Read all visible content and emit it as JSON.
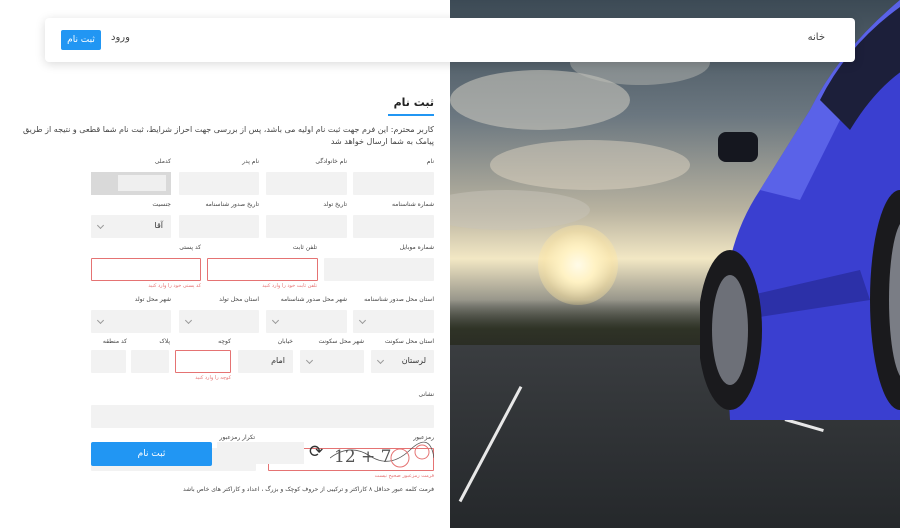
{
  "nav": {
    "home": "خانه",
    "login": "ورود",
    "register": "ثبت نام"
  },
  "form": {
    "title": "ثبت نام",
    "intro": "کاربر محترم: این فرم جهت ثبت نام اولیه می باشد، پس از بررسی جهت احراز شرایط، ثبت نام شما قطعی و نتیجه از طریق پیامک به شما ارسال خواهد شد",
    "labels": {
      "first_name": "نام",
      "last_name": "نام خانوادگی",
      "father_name": "نام پدر",
      "national_code": "کدملی",
      "id_number": "شماره شناسنامه",
      "birth_date": "تاریخ تولد",
      "id_issue_date": "تاریخ صدور شناسنامه",
      "gender": "جنسیت",
      "mobile": "شماره موبایل",
      "phone": "تلفن ثابت",
      "postal_code": "کد پستی",
      "issue_province": "استان محل صدور شناسنامه",
      "issue_city": "شهر محل صدور شناسنامه",
      "birth_province": "استان محل تولد",
      "birth_city": "شهر محل تولد",
      "res_province": "استان محل سکونت",
      "res_city": "شهر محل سکونت",
      "street": "خیابان",
      "alley": "کوچه",
      "plaque": "پلاک",
      "area_code": "کد منطقه",
      "address": "نشانی",
      "password": "رمزعبور",
      "password_repeat": "تکرار رمزعبور"
    },
    "values": {
      "gender": "آقا",
      "res_province": "لرستان",
      "street_prefix": "امام"
    },
    "errors": {
      "phone": "تلفن ثابت خود را وارد کنید",
      "postal_code": "کد پستی خود را وارد کنید",
      "alley": "کوچه را وارد کنید",
      "password": "فرمت رمزعبور صحیح نیست"
    },
    "password_hint": "فرمت کلمه عبور حداقل ۸ کاراکتر و ترکیبی از حروف کوچک و بزرگ ، اعداد و کاراکتر های خاص باشد",
    "submit": "ثبت نام",
    "captcha_text": "12 + 7",
    "refresh_icon": "⟳"
  },
  "colors": {
    "accent": "#2196f3",
    "error": "#e57373",
    "field_bg": "#f2f2f2"
  }
}
